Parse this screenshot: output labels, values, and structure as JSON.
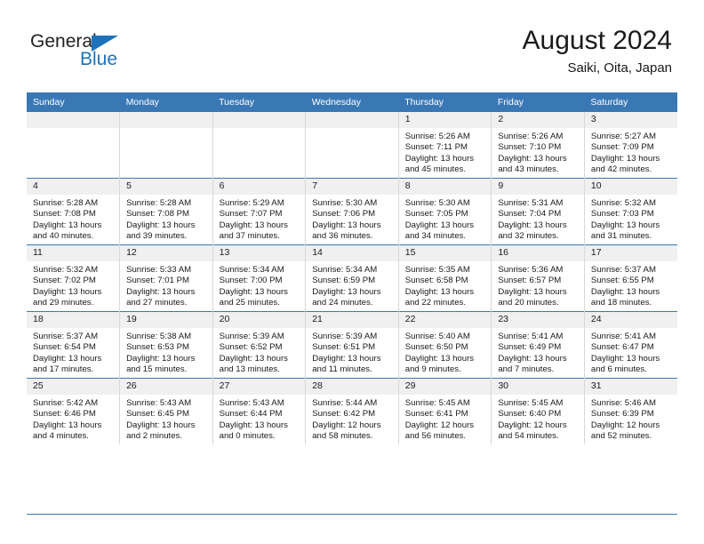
{
  "brand": {
    "name_part1": "General",
    "name_part2": "Blue",
    "triangle_color": "#1f71b8"
  },
  "header": {
    "title": "August 2024",
    "subtitle": "Saiki, Oita, Japan"
  },
  "theme": {
    "header_bar": "#3a78b5",
    "daynum_band": "#f0f0f0",
    "text": "#1a1a1a"
  },
  "weekdays": [
    "Sunday",
    "Monday",
    "Tuesday",
    "Wednesday",
    "Thursday",
    "Friday",
    "Saturday"
  ],
  "weeks": [
    [
      {
        "day": "",
        "empty": true,
        "lines": []
      },
      {
        "day": "",
        "empty": true,
        "lines": []
      },
      {
        "day": "",
        "empty": true,
        "lines": []
      },
      {
        "day": "",
        "empty": true,
        "lines": []
      },
      {
        "day": "1",
        "empty": false,
        "lines": [
          "Sunrise: 5:26 AM",
          "Sunset: 7:11 PM",
          "Daylight: 13 hours",
          "and 45 minutes."
        ]
      },
      {
        "day": "2",
        "empty": false,
        "lines": [
          "Sunrise: 5:26 AM",
          "Sunset: 7:10 PM",
          "Daylight: 13 hours",
          "and 43 minutes."
        ]
      },
      {
        "day": "3",
        "empty": false,
        "lines": [
          "Sunrise: 5:27 AM",
          "Sunset: 7:09 PM",
          "Daylight: 13 hours",
          "and 42 minutes."
        ]
      }
    ],
    [
      {
        "day": "4",
        "empty": false,
        "lines": [
          "Sunrise: 5:28 AM",
          "Sunset: 7:08 PM",
          "Daylight: 13 hours",
          "and 40 minutes."
        ]
      },
      {
        "day": "5",
        "empty": false,
        "lines": [
          "Sunrise: 5:28 AM",
          "Sunset: 7:08 PM",
          "Daylight: 13 hours",
          "and 39 minutes."
        ]
      },
      {
        "day": "6",
        "empty": false,
        "lines": [
          "Sunrise: 5:29 AM",
          "Sunset: 7:07 PM",
          "Daylight: 13 hours",
          "and 37 minutes."
        ]
      },
      {
        "day": "7",
        "empty": false,
        "lines": [
          "Sunrise: 5:30 AM",
          "Sunset: 7:06 PM",
          "Daylight: 13 hours",
          "and 36 minutes."
        ]
      },
      {
        "day": "8",
        "empty": false,
        "lines": [
          "Sunrise: 5:30 AM",
          "Sunset: 7:05 PM",
          "Daylight: 13 hours",
          "and 34 minutes."
        ]
      },
      {
        "day": "9",
        "empty": false,
        "lines": [
          "Sunrise: 5:31 AM",
          "Sunset: 7:04 PM",
          "Daylight: 13 hours",
          "and 32 minutes."
        ]
      },
      {
        "day": "10",
        "empty": false,
        "lines": [
          "Sunrise: 5:32 AM",
          "Sunset: 7:03 PM",
          "Daylight: 13 hours",
          "and 31 minutes."
        ]
      }
    ],
    [
      {
        "day": "11",
        "empty": false,
        "lines": [
          "Sunrise: 5:32 AM",
          "Sunset: 7:02 PM",
          "Daylight: 13 hours",
          "and 29 minutes."
        ]
      },
      {
        "day": "12",
        "empty": false,
        "lines": [
          "Sunrise: 5:33 AM",
          "Sunset: 7:01 PM",
          "Daylight: 13 hours",
          "and 27 minutes."
        ]
      },
      {
        "day": "13",
        "empty": false,
        "lines": [
          "Sunrise: 5:34 AM",
          "Sunset: 7:00 PM",
          "Daylight: 13 hours",
          "and 25 minutes."
        ]
      },
      {
        "day": "14",
        "empty": false,
        "lines": [
          "Sunrise: 5:34 AM",
          "Sunset: 6:59 PM",
          "Daylight: 13 hours",
          "and 24 minutes."
        ]
      },
      {
        "day": "15",
        "empty": false,
        "lines": [
          "Sunrise: 5:35 AM",
          "Sunset: 6:58 PM",
          "Daylight: 13 hours",
          "and 22 minutes."
        ]
      },
      {
        "day": "16",
        "empty": false,
        "lines": [
          "Sunrise: 5:36 AM",
          "Sunset: 6:57 PM",
          "Daylight: 13 hours",
          "and 20 minutes."
        ]
      },
      {
        "day": "17",
        "empty": false,
        "lines": [
          "Sunrise: 5:37 AM",
          "Sunset: 6:55 PM",
          "Daylight: 13 hours",
          "and 18 minutes."
        ]
      }
    ],
    [
      {
        "day": "18",
        "empty": false,
        "lines": [
          "Sunrise: 5:37 AM",
          "Sunset: 6:54 PM",
          "Daylight: 13 hours",
          "and 17 minutes."
        ]
      },
      {
        "day": "19",
        "empty": false,
        "lines": [
          "Sunrise: 5:38 AM",
          "Sunset: 6:53 PM",
          "Daylight: 13 hours",
          "and 15 minutes."
        ]
      },
      {
        "day": "20",
        "empty": false,
        "lines": [
          "Sunrise: 5:39 AM",
          "Sunset: 6:52 PM",
          "Daylight: 13 hours",
          "and 13 minutes."
        ]
      },
      {
        "day": "21",
        "empty": false,
        "lines": [
          "Sunrise: 5:39 AM",
          "Sunset: 6:51 PM",
          "Daylight: 13 hours",
          "and 11 minutes."
        ]
      },
      {
        "day": "22",
        "empty": false,
        "lines": [
          "Sunrise: 5:40 AM",
          "Sunset: 6:50 PM",
          "Daylight: 13 hours",
          "and 9 minutes."
        ]
      },
      {
        "day": "23",
        "empty": false,
        "lines": [
          "Sunrise: 5:41 AM",
          "Sunset: 6:49 PM",
          "Daylight: 13 hours",
          "and 7 minutes."
        ]
      },
      {
        "day": "24",
        "empty": false,
        "lines": [
          "Sunrise: 5:41 AM",
          "Sunset: 6:47 PM",
          "Daylight: 13 hours",
          "and 6 minutes."
        ]
      }
    ],
    [
      {
        "day": "25",
        "empty": false,
        "lines": [
          "Sunrise: 5:42 AM",
          "Sunset: 6:46 PM",
          "Daylight: 13 hours",
          "and 4 minutes."
        ]
      },
      {
        "day": "26",
        "empty": false,
        "lines": [
          "Sunrise: 5:43 AM",
          "Sunset: 6:45 PM",
          "Daylight: 13 hours",
          "and 2 minutes."
        ]
      },
      {
        "day": "27",
        "empty": false,
        "lines": [
          "Sunrise: 5:43 AM",
          "Sunset: 6:44 PM",
          "Daylight: 13 hours",
          "and 0 minutes."
        ]
      },
      {
        "day": "28",
        "empty": false,
        "lines": [
          "Sunrise: 5:44 AM",
          "Sunset: 6:42 PM",
          "Daylight: 12 hours",
          "and 58 minutes."
        ]
      },
      {
        "day": "29",
        "empty": false,
        "lines": [
          "Sunrise: 5:45 AM",
          "Sunset: 6:41 PM",
          "Daylight: 12 hours",
          "and 56 minutes."
        ]
      },
      {
        "day": "30",
        "empty": false,
        "lines": [
          "Sunrise: 5:45 AM",
          "Sunset: 6:40 PM",
          "Daylight: 12 hours",
          "and 54 minutes."
        ]
      },
      {
        "day": "31",
        "empty": false,
        "lines": [
          "Sunrise: 5:46 AM",
          "Sunset: 6:39 PM",
          "Daylight: 12 hours",
          "and 52 minutes."
        ]
      }
    ]
  ]
}
